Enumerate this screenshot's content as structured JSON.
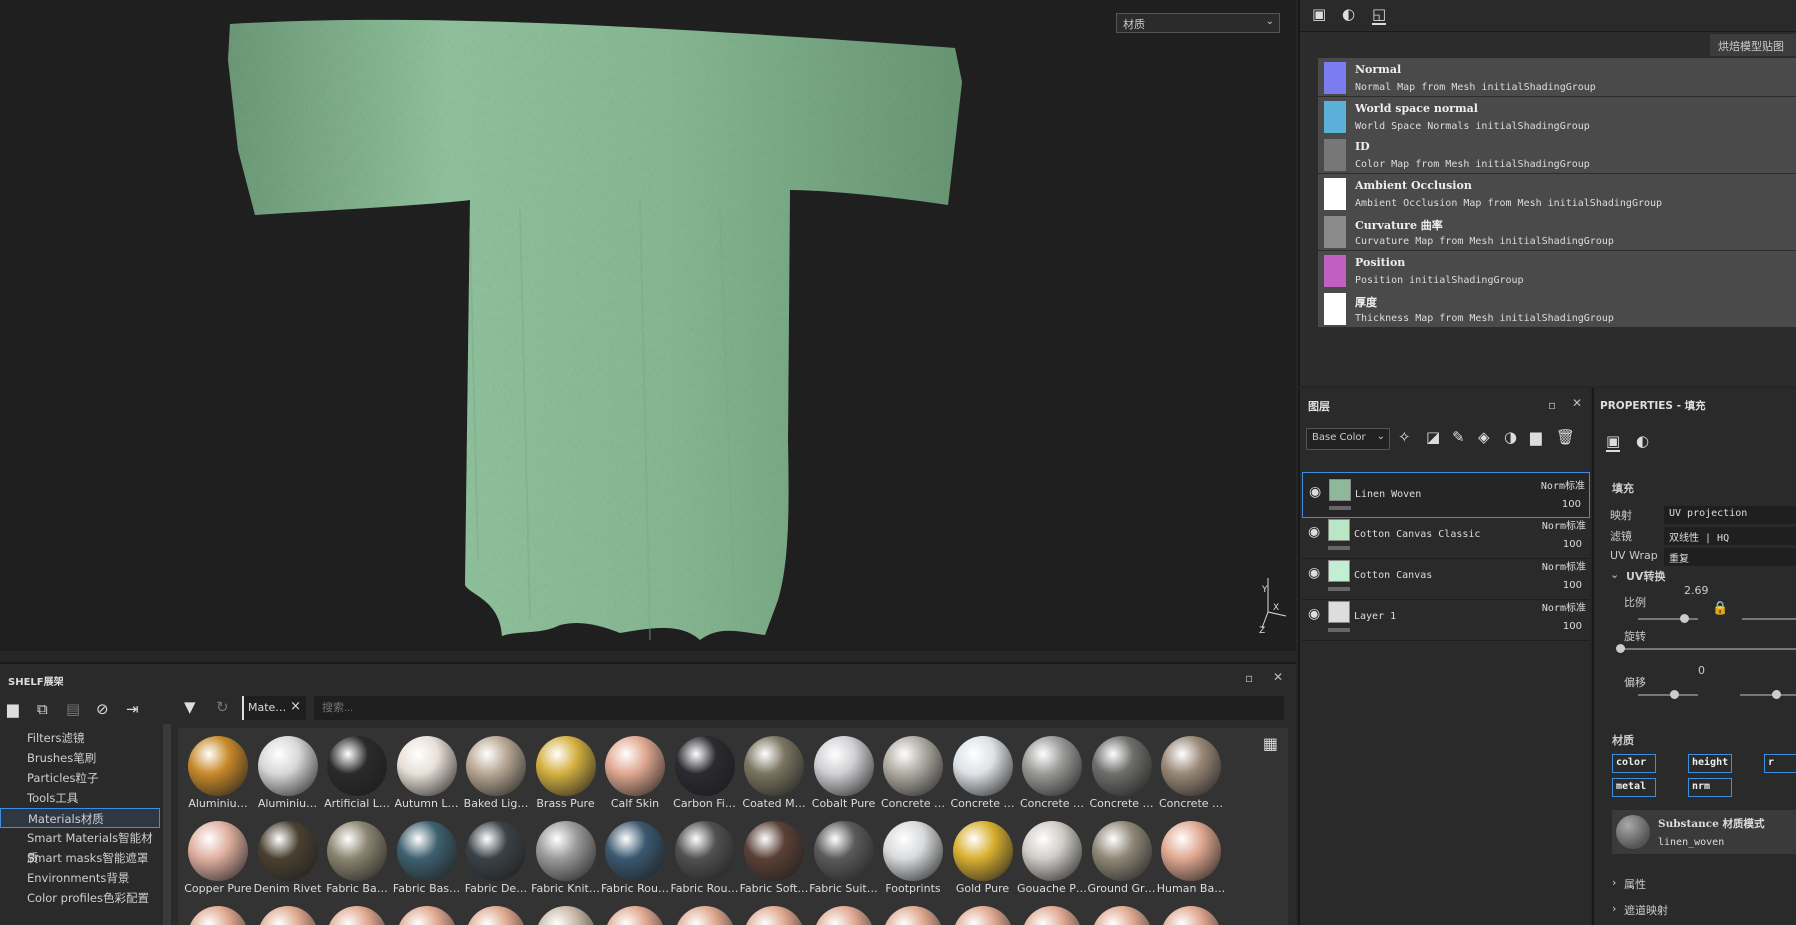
{
  "viewport": {
    "channel_select": "材质",
    "axis_labels": [
      "Y",
      "Z",
      "X"
    ]
  },
  "bake": {
    "button": "烘焙模型贴图",
    "maps": [
      {
        "title": "Normal",
        "desc": "Normal Map from Mesh initialShadingGroup",
        "thumb_color": "#7a7cf0"
      },
      {
        "title": "World space normal",
        "desc": "World Space Normals initialShadingGroup",
        "thumb_color": "#5ab0d8"
      },
      {
        "title": "ID",
        "desc": "Color Map from Mesh initialShadingGroup",
        "thumb_color": "#777777"
      },
      {
        "title": "Ambient Occlusion",
        "desc": "Ambient Occlusion Map from Mesh initialShadingGroup",
        "thumb_color": "#ffffff"
      },
      {
        "title": "Curvature 曲率",
        "desc": "Curvature Map from Mesh initialShadingGroup",
        "thumb_color": "#8a8a8a"
      },
      {
        "title": "Position",
        "desc": "Position initialShadingGroup",
        "thumb_color": "#c060c0"
      },
      {
        "title": "厚度",
        "desc": "Thickness Map from Mesh initialShadingGroup",
        "thumb_color": "#ffffff"
      }
    ]
  },
  "layers": {
    "title": "图层",
    "channel": "Base Color",
    "items": [
      {
        "name": "Linen Woven",
        "blend": "Norm标准",
        "opacity": "100",
        "thumb": "#8fb89a"
      },
      {
        "name": "Cotton Canvas Classic",
        "blend": "Norm标准",
        "opacity": "100",
        "thumb": "#b9e6c4"
      },
      {
        "name": "Cotton Canvas",
        "blend": "Norm标准",
        "opacity": "100",
        "thumb": "#c2efd2"
      },
      {
        "name": "Layer 1",
        "blend": "Norm标准",
        "opacity": "100",
        "thumb": "#dddddd"
      }
    ]
  },
  "properties": {
    "title": "PROPERTIES - 填充",
    "fill_label": "填充",
    "mapping_label": "映射",
    "mapping_value": "UV projection",
    "filter_label": "滤镜",
    "filter_value": "双线性 | HQ",
    "uvwrap_label": "UV Wrap",
    "uvwrap_value": "重复",
    "uv_transform": "UV转换",
    "scale_label": "比例",
    "scale_value": "2.69",
    "rotate_label": "旋转",
    "offset_label": "偏移",
    "offset_value": "0",
    "material_label": "材质",
    "channels": [
      "color",
      "height",
      "r",
      "metal",
      "nrm"
    ],
    "substance_title": "Substance 材质模式",
    "substance_name": "linen_woven",
    "attributes": "属性",
    "advanced": "遮道映射"
  },
  "shelf": {
    "title": "SHELF展架",
    "filter_chip": "Mate…",
    "search_placeholder": "搜索...",
    "categories": [
      "Filters滤镜",
      "Brushes笔刷",
      "Particles粒子",
      "Tools工具",
      "Materials材质",
      "Smart Materials智能材质",
      "Smart masks智能遮罩",
      "Environments背景",
      "Color profiles色彩配置"
    ],
    "active_category": "Materials材质",
    "assets": [
      {
        "label": "Aluminiu…",
        "color": "#c88a2a"
      },
      {
        "label": "Aluminiu…",
        "color": "#d8d8d8"
      },
      {
        "label": "Artificial L…",
        "color": "#2a2a2a"
      },
      {
        "label": "Autumn L…",
        "color": "#e8e0d8"
      },
      {
        "label": "Baked Lig…",
        "color": "#b8a894"
      },
      {
        "label": "Brass Pure",
        "color": "#d4b040"
      },
      {
        "label": "Calf Skin",
        "color": "#e0a890"
      },
      {
        "label": "Carbon Fi…",
        "color": "#2a2a30"
      },
      {
        "label": "Coated M…",
        "color": "#7a7460"
      },
      {
        "label": "Cobalt Pure",
        "color": "#d0d0d4"
      },
      {
        "label": "Concrete …",
        "color": "#b0aca4"
      },
      {
        "label": "Concrete …",
        "color": "#dde2e6"
      },
      {
        "label": "Concrete …",
        "color": "#9a9a98"
      },
      {
        "label": "Concrete …",
        "color": "#6e6e6c"
      },
      {
        "label": "Concrete …",
        "color": "#9a8878"
      },
      {
        "label": "Copper Pure",
        "color": "#e0b0a0"
      },
      {
        "label": "Denim Rivet",
        "color": "#4a4030"
      },
      {
        "label": "Fabric Ba…",
        "color": "#8a8470"
      },
      {
        "label": "Fabric Bas…",
        "color": "#3e6070"
      },
      {
        "label": "Fabric De…",
        "color": "#3a4248"
      },
      {
        "label": "Fabric Knit…",
        "color": "#9a9a9c"
      },
      {
        "label": "Fabric Rou…",
        "color": "#3a5870"
      },
      {
        "label": "Fabric Rou…",
        "color": "#505050"
      },
      {
        "label": "Fabric Soft…",
        "color": "#5a4036"
      },
      {
        "label": "Fabric Suit…",
        "color": "#5a5a5a"
      },
      {
        "label": "Footprints",
        "color": "#d8dadc"
      },
      {
        "label": "Gold Pure",
        "color": "#d8b030"
      },
      {
        "label": "Gouache P…",
        "color": "#d0ccc8"
      },
      {
        "label": "Ground Gr…",
        "color": "#908878"
      },
      {
        "label": "Human Ba…",
        "color": "#e0a890"
      }
    ],
    "next_row_colors": [
      "#e0a890",
      "#e0a890",
      "#e0a890",
      "#e0a890",
      "#e0a890",
      "#c8b8a8",
      "#e0a890",
      "#e0a890",
      "#e0a890",
      "#e0a890",
      "#e0a890",
      "#e0a890",
      "#e0a890",
      "#e0a890",
      "#e0a890"
    ]
  }
}
